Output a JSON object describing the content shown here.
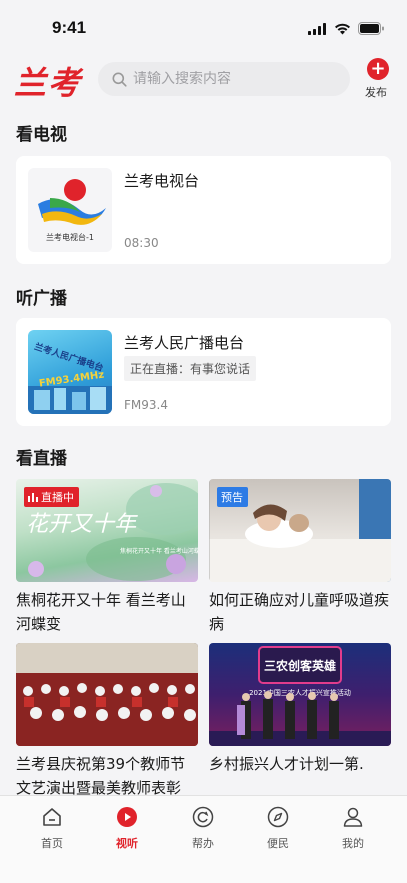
{
  "status_bar": {
    "time": "9:41"
  },
  "header": {
    "logo": "兰考",
    "search_placeholder": "请输入搜索内容",
    "publish_label": "发布"
  },
  "tv": {
    "section_title": "看电视",
    "title": "兰考电视台",
    "time": "08:30",
    "thumb_text": "兰考电视台-1"
  },
  "radio": {
    "section_title": "听广播",
    "title": "兰考人民广播电台",
    "live_tag": "正在直播：有事您说话",
    "frequency": "FM93.4",
    "thumb_text": "兰考人民广播电台",
    "thumb_fm": "FM93.4MHz"
  },
  "live": {
    "section_title": "看直播",
    "items": [
      {
        "title": "焦桐花开又十年 看兰考山河蝶变",
        "badge": "直播中",
        "badge_color": "#e0232b",
        "art_text": "花开又十年",
        "art_sub": "焦桐花开又十年 看兰考山河蝶变"
      },
      {
        "title": "如何正确应对儿童呼吸道疾病",
        "badge": "预告",
        "badge_color": "#2d7be5"
      },
      {
        "title": "兰考县庆祝第39个教师节文艺演出暨最美教师表彰",
        "badge": ""
      },
      {
        "title": "乡村振兴人才计划一第.",
        "badge": "",
        "art_title": "三农创客英雄",
        "art_sub": "2021中国三农人才振兴宣推活动"
      }
    ]
  },
  "tabbar": {
    "tabs": [
      {
        "label": "首页",
        "icon": "home-icon"
      },
      {
        "label": "视听",
        "icon": "play-icon"
      },
      {
        "label": "帮办",
        "icon": "refresh-icon"
      },
      {
        "label": "便民",
        "icon": "compass-icon"
      },
      {
        "label": "我的",
        "icon": "user-icon"
      }
    ],
    "active_index": 1
  }
}
